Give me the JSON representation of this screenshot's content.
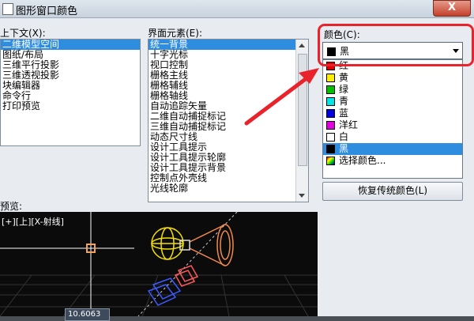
{
  "window": {
    "title": "图形窗口颜色",
    "close_label": "X"
  },
  "context": {
    "label": "上下文(X):",
    "items": [
      "二维模型空间",
      "图纸/布局",
      "三维平行投影",
      "三维透视投影",
      "块编辑器",
      "命令行",
      "打印预览"
    ],
    "selected_index": 0
  },
  "elements": {
    "label": "界面元素(E):",
    "items": [
      "统一背景",
      "十字光标",
      "视口控制",
      "栅格主线",
      "栅格辅线",
      "栅格轴线",
      "自动追踪矢量",
      "二维自动捕捉标记",
      "三维自动捕捉标记",
      "动态尺寸线",
      "设计工具提示",
      "设计工具提示轮廓",
      "设计工具提示背景",
      "控制点外壳线",
      "光线轮廓"
    ],
    "selected_index": 0
  },
  "color": {
    "label": "颜色(C):",
    "current_value": "黑",
    "current_swatch": "#000000",
    "options": [
      {
        "label": "红",
        "swatch": "#e00000"
      },
      {
        "label": "黄",
        "swatch": "#ffee00"
      },
      {
        "label": "绿",
        "swatch": "#00c000"
      },
      {
        "label": "青",
        "swatch": "#00e6e6"
      },
      {
        "label": "蓝",
        "swatch": "#0000e0"
      },
      {
        "label": "洋红",
        "swatch": "#e000e0"
      },
      {
        "label": "白",
        "swatch": "#ffffff"
      },
      {
        "label": "黑",
        "swatch": "#000000"
      },
      {
        "label": "选择颜色...",
        "swatch": "multicolor-icon"
      }
    ],
    "highlighted_index": 7
  },
  "restore_button": "恢复传统颜色(L)",
  "preview": {
    "label": "预览:",
    "viewport_label": "[+][上][X-射线]",
    "coordinate": "10.6063"
  },
  "accent": {
    "highlight": "#e8232b",
    "selection": "#2f8de0"
  }
}
